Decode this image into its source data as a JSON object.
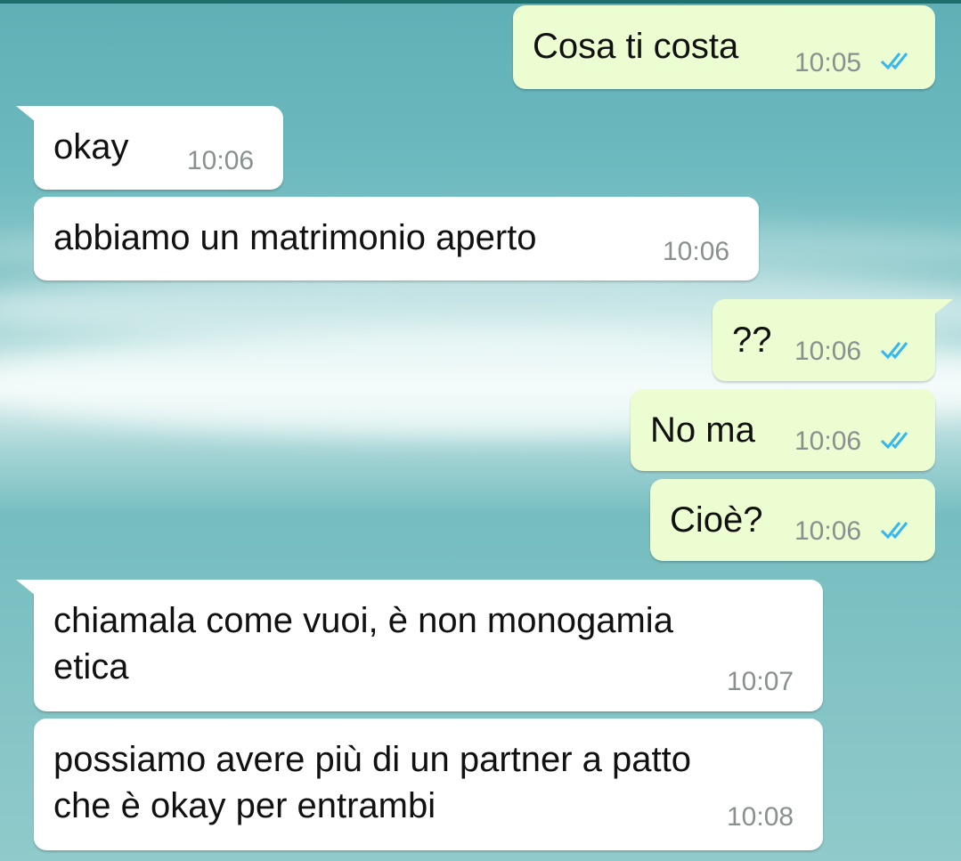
{
  "colors": {
    "incoming_bubble": "#ffffff",
    "outgoing_bubble": "#ecfdd2",
    "timestamp": "#8a8f8f",
    "read_ticks": "#34b7f1"
  },
  "messages": [
    {
      "direction": "out",
      "text": "Cosa ti costa",
      "time": "10:05",
      "status": "read",
      "icon": "double-check-icon"
    },
    {
      "direction": "in",
      "text": "okay",
      "time": "10:06"
    },
    {
      "direction": "in",
      "text": "abbiamo un matrimonio aperto",
      "time": "10:06"
    },
    {
      "direction": "out",
      "text": "??",
      "time": "10:06",
      "status": "read",
      "icon": "double-check-icon"
    },
    {
      "direction": "out",
      "text": "No ma",
      "time": "10:06",
      "status": "read",
      "icon": "double-check-icon"
    },
    {
      "direction": "out",
      "text": "Cioè?",
      "time": "10:06",
      "status": "read",
      "icon": "double-check-icon"
    },
    {
      "direction": "in",
      "text": "chiamala come vuoi, è non monogamia\netica",
      "time": "10:07"
    },
    {
      "direction": "in",
      "text": "possiamo avere più di un partner a patto\nche è okay per entrambi",
      "time": "10:08"
    }
  ]
}
